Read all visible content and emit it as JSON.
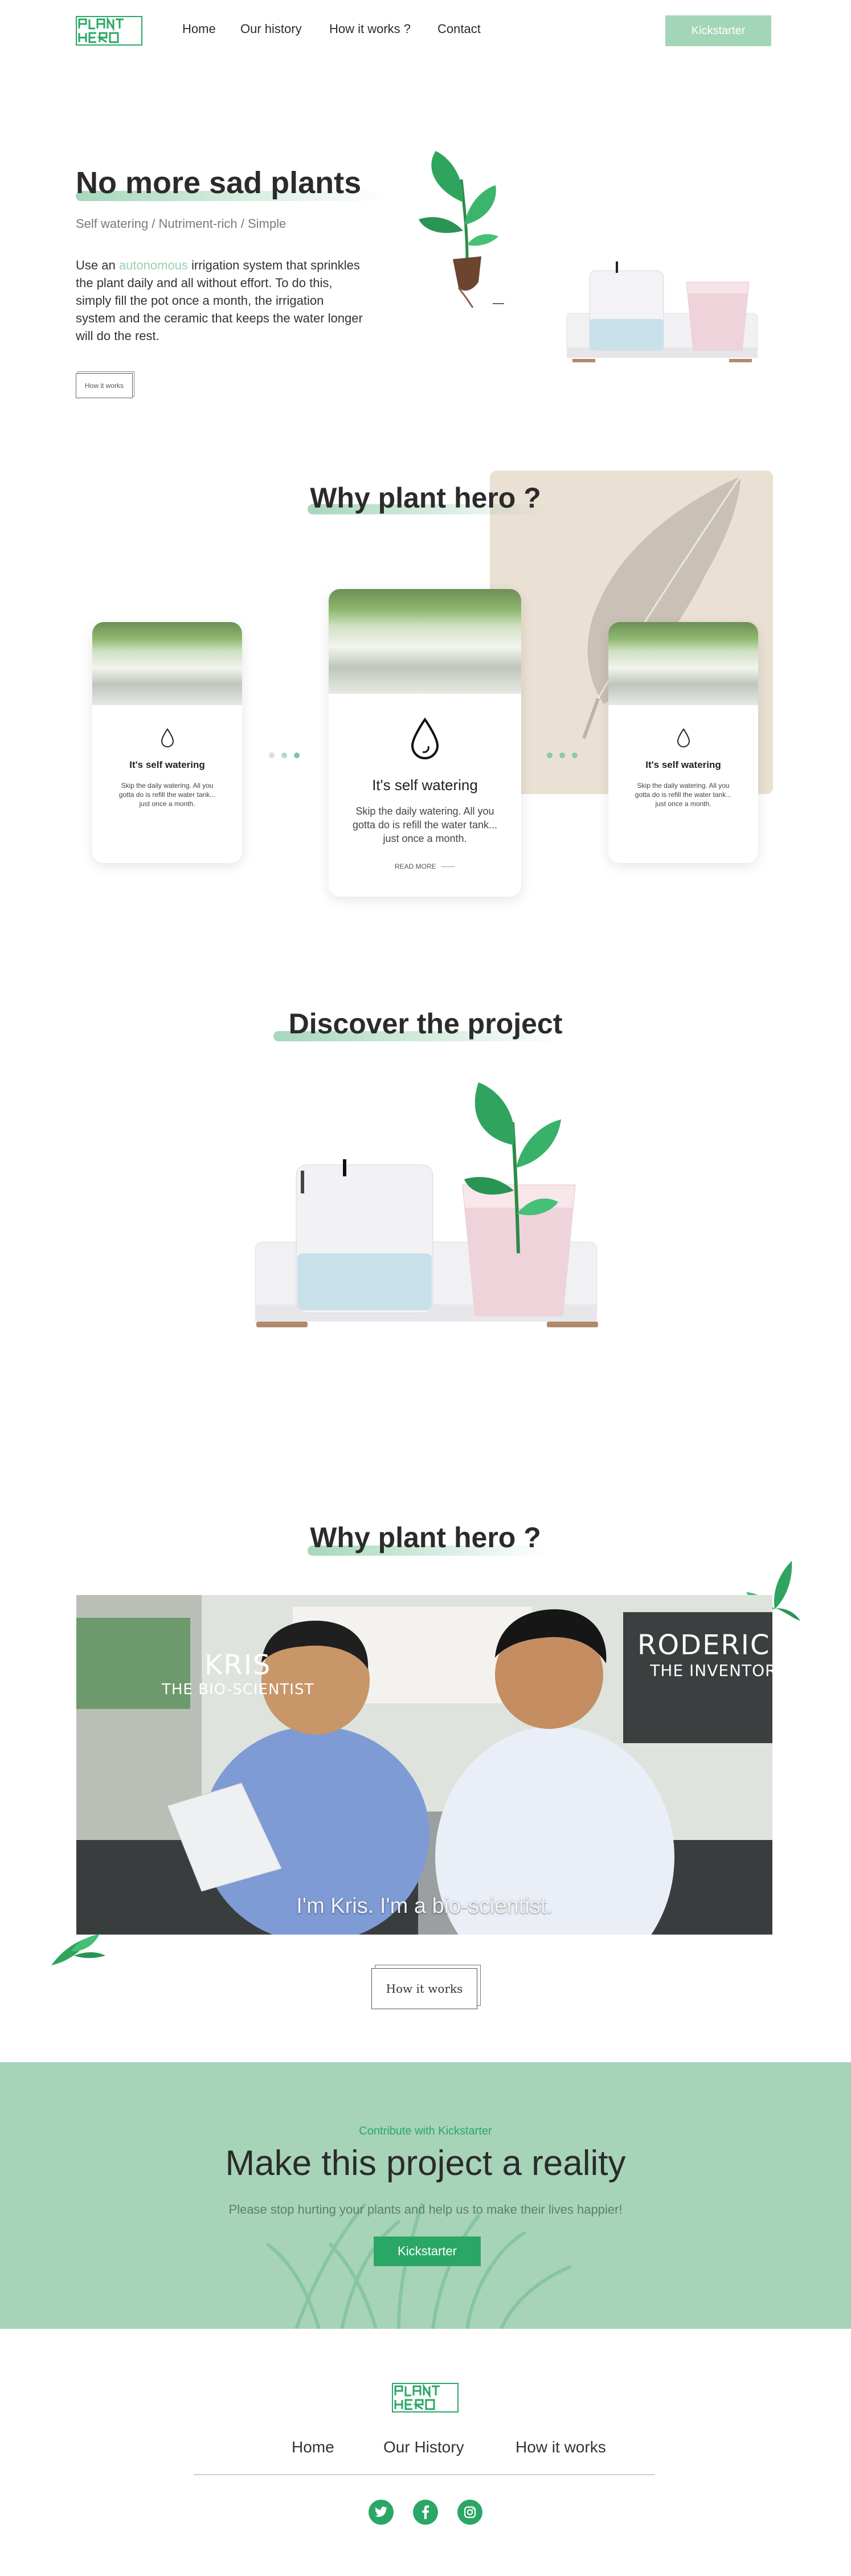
{
  "brand": {
    "logo_text": "PLANT HERO",
    "accent": "#2aa765",
    "light_accent": "#a3d5b8",
    "beige": "#eae0d3"
  },
  "nav": {
    "items": [
      "Home",
      "Our history",
      "How it works ?",
      "Contact"
    ],
    "cta": "Kickstarter"
  },
  "hero": {
    "title": "No more sad plants",
    "subtitle": "Self watering / Nutriment-rich / Simple",
    "body_prefix": "Use an ",
    "body_accent": "autonomous",
    "body_suffix": " irrigation system that sprinkles the plant daily and all without effort. To do this, simply fill the pot once a month, the irrigation system and the ceramic that keeps the water longer will do the rest.",
    "button": "How it works"
  },
  "why": {
    "title": "Why plant hero ?",
    "cards": [
      {
        "title": "It's self watering",
        "desc": "Skip the daily watering. All you gotta do is refill the water tank... just once a month."
      },
      {
        "title": "It's self watering",
        "desc": "Skip the daily watering. All you gotta do is refill the water tank... just once a month.",
        "link": "READ MORE"
      },
      {
        "title": "It's self watering",
        "desc": "Skip the daily watering. All you gotta do is refill the water tank... just once a month."
      }
    ]
  },
  "discover": {
    "title": "Discover the project"
  },
  "video": {
    "title": "Why plant hero ?",
    "left_name": "KRIS",
    "left_role": "THE BIO-SCIENTIST",
    "right_name": "RODERICK",
    "right_role": "THE INVENTOR",
    "subtitle": "I'm Kris. I'm a bio-scientist.",
    "button": "How it works"
  },
  "kickstarter": {
    "eyebrow": "Contribute with Kickstarter",
    "title": "Make this project a reality",
    "text": "Please stop hurting your plants and help us to make their lives happier!",
    "button": "Kickstarter"
  },
  "footer": {
    "links": [
      "Home",
      "Our History",
      "How it works"
    ],
    "social": [
      "twitter-icon",
      "facebook-icon",
      "instagram-icon"
    ]
  }
}
